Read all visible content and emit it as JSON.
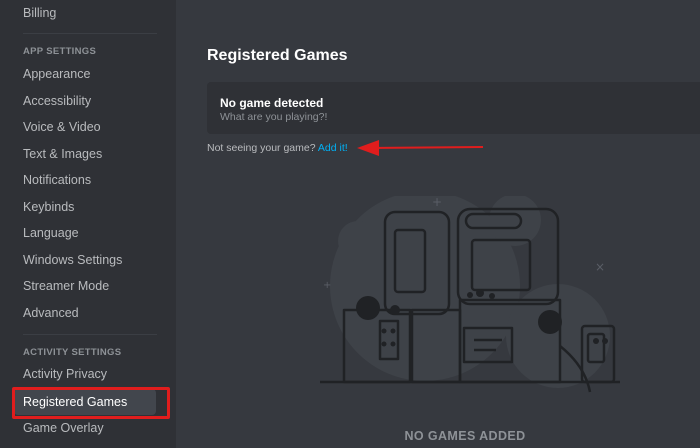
{
  "sidebar": {
    "top_item": "Billing",
    "app_settings_header": "APP SETTINGS",
    "app_items": [
      "Appearance",
      "Accessibility",
      "Voice & Video",
      "Text & Images",
      "Notifications",
      "Keybinds",
      "Language",
      "Windows Settings",
      "Streamer Mode",
      "Advanced"
    ],
    "activity_settings_header": "ACTIVITY SETTINGS",
    "activity_items": [
      "Activity Privacy",
      "Registered Games",
      "Game Overlay"
    ],
    "selected": "Registered Games"
  },
  "main": {
    "title": "Registered Games",
    "detect": {
      "title": "No game detected",
      "subtitle": "What are you playing?!"
    },
    "not_seeing_text": "Not seeing your game?",
    "add_link": "Add it!",
    "empty_state": "NO GAMES ADDED"
  },
  "colors": {
    "background": "#36393f",
    "sidebar": "#2f3136",
    "accent_link": "#00b0f4",
    "annotation_red": "#e01d1d"
  }
}
